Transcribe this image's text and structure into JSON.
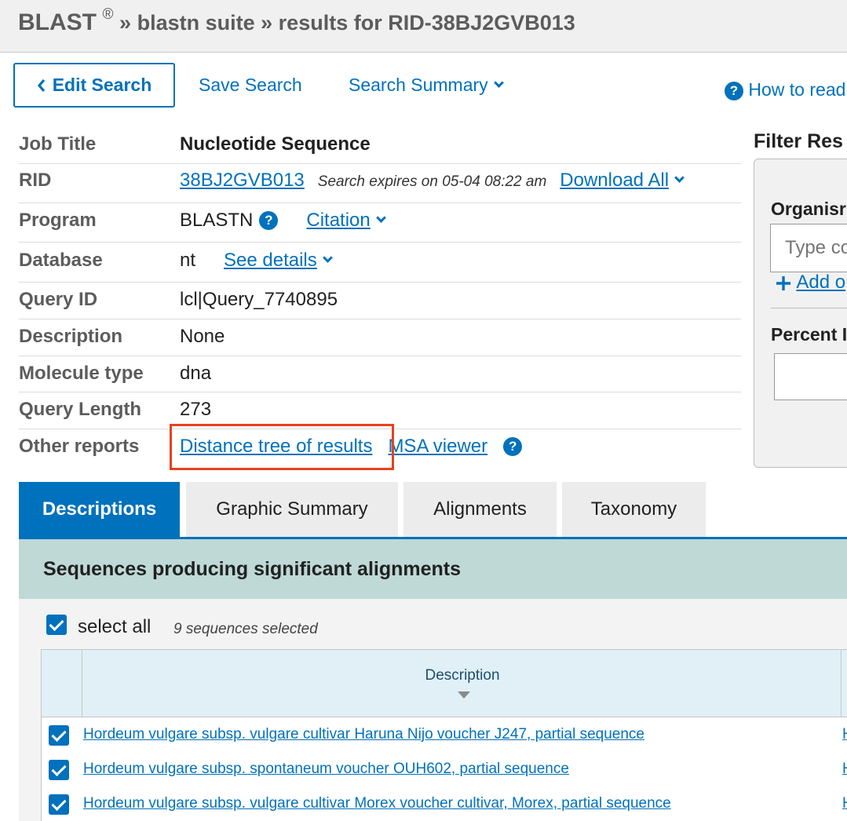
{
  "breadcrumb": {
    "brand": "BLAST",
    "registered": "®",
    "sep": "»",
    "suite": "blastn suite",
    "results": "results for RID-38BJ2GVB013"
  },
  "toolbar": {
    "edit_search": "Edit Search",
    "save_search": "Save Search",
    "search_summary": "Search Summary",
    "how_to_read": "How to read"
  },
  "job": {
    "rows": [
      {
        "label": "Job Title",
        "value": "Nucleotide Sequence"
      },
      {
        "label": "RID",
        "value": "38BJ2GVB013",
        "expires": "Search expires on 05-04 08:22 am",
        "download": "Download All"
      },
      {
        "label": "Program",
        "value": "BLASTN",
        "citation": "Citation"
      },
      {
        "label": "Database",
        "value": "nt",
        "details": "See details"
      },
      {
        "label": "Query ID",
        "value": "lcl|Query_7740895"
      },
      {
        "label": "Description",
        "value": "None"
      },
      {
        "label": "Molecule type",
        "value": "dna"
      },
      {
        "label": "Query Length",
        "value": "273"
      },
      {
        "label": "Other reports",
        "tree": "Distance tree of results",
        "msa": "MSA viewer"
      }
    ]
  },
  "filter": {
    "title": "Filter Res",
    "organism_label": "Organisr",
    "organism_placeholder": "Type co",
    "add_label": "Add o",
    "percent_label": "Percent I"
  },
  "tabs": [
    {
      "label": "Descriptions",
      "active": true
    },
    {
      "label": "Graphic Summary",
      "active": false
    },
    {
      "label": "Alignments",
      "active": false
    },
    {
      "label": "Taxonomy",
      "active": false
    }
  ],
  "results": {
    "heading": "Sequences producing significant alignments",
    "select_all": "select all",
    "selected_count": "9 sequences selected",
    "column_description": "Description",
    "rows": [
      {
        "description": "Hordeum vulgare subsp. vulgare cultivar Haruna Nijo voucher J247, partial sequence",
        "next": "H"
      },
      {
        "description": "Hordeum vulgare subsp. spontaneum voucher OUH602, partial sequence",
        "next": "H"
      },
      {
        "description": "Hordeum vulgare subsp. vulgare cultivar Morex voucher cultivar, Morex, partial sequence",
        "next": "H"
      }
    ]
  },
  "colors": {
    "link": "#0071bc",
    "highlight_box": "#e8411d",
    "results_header": "#bed9d6"
  }
}
